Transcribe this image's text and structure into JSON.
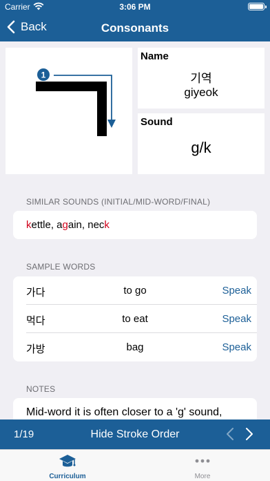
{
  "status_bar": {
    "carrier": "Carrier",
    "time": "3:06 PM"
  },
  "nav": {
    "back_label": "Back",
    "title": "Consonants"
  },
  "letter": {
    "glyph": "ㄱ",
    "stroke_number": "1",
    "name_label": "Name",
    "name_hangul": "기역",
    "name_roman": "giyeok",
    "sound_label": "Sound",
    "sound_value": "g/k"
  },
  "similar_sounds": {
    "header": "SIMILAR SOUNDS (INITIAL/MID-WORD/FINAL)",
    "parts": [
      {
        "text": "k",
        "highlight": true
      },
      {
        "text": "ettle, a",
        "highlight": false
      },
      {
        "text": "g",
        "highlight": true
      },
      {
        "text": "ain, nec",
        "highlight": false
      },
      {
        "text": "k",
        "highlight": true
      }
    ]
  },
  "sample_words": {
    "header": "SAMPLE WORDS",
    "speak_label": "Speak",
    "rows": [
      {
        "korean": "가다",
        "english": "to go"
      },
      {
        "korean": "먹다",
        "english": "to eat"
      },
      {
        "korean": "가방",
        "english": "bag"
      }
    ]
  },
  "notes": {
    "header": "NOTES",
    "text": "Mid-word it is often closer to a 'g' sound,"
  },
  "toolbar": {
    "page": "1/19",
    "toggle_label": "Hide Stroke Order"
  },
  "tabs": [
    {
      "label": "Curriculum",
      "icon": "graduation-cap-icon"
    },
    {
      "label": "More",
      "icon": "ellipsis-icon"
    }
  ],
  "colors": {
    "brand": "#1c5f97",
    "highlight": "#d0021b",
    "background": "#f0eff4"
  }
}
